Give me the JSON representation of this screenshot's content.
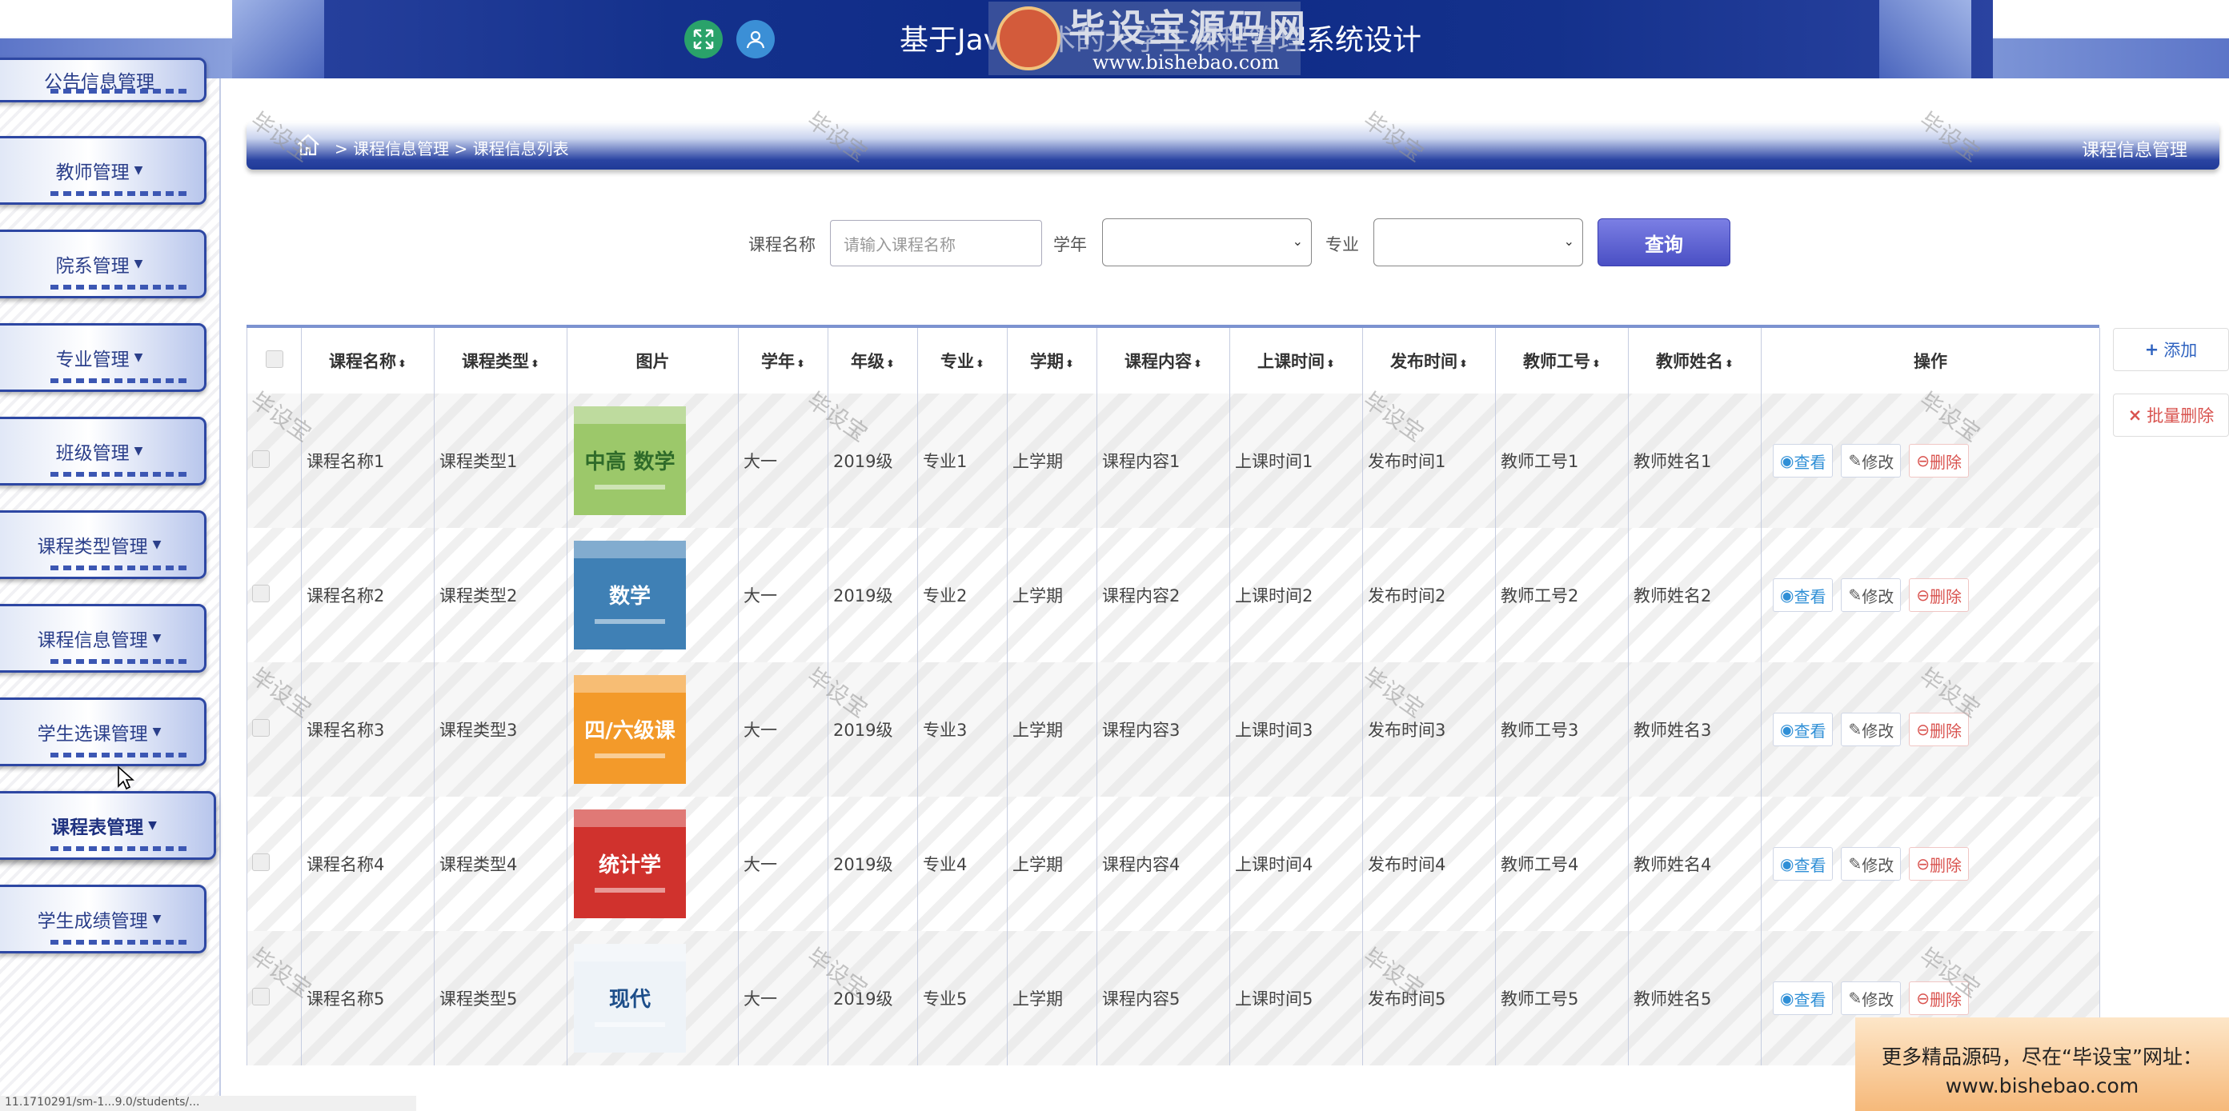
{
  "header": {
    "title": "基于Java技术的大学生课程管理系统设计",
    "logo_text": "毕设宝源码网",
    "logo_url": "www.bishebao.com",
    "icons": [
      "expand-icon",
      "user-icon"
    ]
  },
  "sidebar": {
    "items": [
      {
        "label": "公告信息管理"
      },
      {
        "label": "教师管理"
      },
      {
        "label": "院系管理"
      },
      {
        "label": "专业管理"
      },
      {
        "label": "班级管理"
      },
      {
        "label": "课程类型管理"
      },
      {
        "label": "课程信息管理"
      },
      {
        "label": "学生选课管理"
      },
      {
        "label": "课程表管理",
        "active": true
      },
      {
        "label": "学生成绩管理"
      }
    ]
  },
  "breadcrumb": {
    "path": "> 课程信息管理 > 课程信息列表",
    "section": "课程信息管理"
  },
  "search": {
    "name_label": "课程名称",
    "name_placeholder": "请输入课程名称",
    "year_label": "学年",
    "year_value": "",
    "major_label": "专业",
    "major_value": "",
    "button": "查询"
  },
  "table": {
    "headers": [
      "课程名称",
      "课程类型",
      "图片",
      "学年",
      "年级",
      "专业",
      "学期",
      "课程内容",
      "上课时间",
      "发布时间",
      "教师工号",
      "教师姓名",
      "操作"
    ],
    "rows": [
      {
        "name": "课程名称1",
        "type": "课程类型1",
        "year": "大一",
        "grade": "2019级",
        "major": "专业1",
        "term": "上学期",
        "content": "课程内容1",
        "time": "上课时间1",
        "publish": "发布时间1",
        "tid": "教师工号1",
        "tname": "教师姓名1"
      },
      {
        "name": "课程名称2",
        "type": "课程类型2",
        "year": "大一",
        "grade": "2019级",
        "major": "专业2",
        "term": "上学期",
        "content": "课程内容2",
        "time": "上课时间2",
        "publish": "发布时间2",
        "tid": "教师工号2",
        "tname": "教师姓名2"
      },
      {
        "name": "课程名称3",
        "type": "课程类型3",
        "year": "大一",
        "grade": "2019级",
        "major": "专业3",
        "term": "上学期",
        "content": "课程内容3",
        "time": "上课时间3",
        "publish": "发布时间3",
        "tid": "教师工号3",
        "tname": "教师姓名3"
      },
      {
        "name": "课程名称4",
        "type": "课程类型4",
        "year": "大一",
        "grade": "2019级",
        "major": "专业4",
        "term": "上学期",
        "content": "课程内容4",
        "time": "上课时间4",
        "publish": "发布时间4",
        "tid": "教师工号4",
        "tname": "教师姓名4"
      },
      {
        "name": "课程名称5",
        "type": "课程类型5",
        "year": "大一",
        "grade": "2019级",
        "major": "专业5",
        "term": "上学期",
        "content": "课程内容5",
        "time": "上课时间5",
        "publish": "发布时间5",
        "tid": "教师工号5",
        "tname": "教师姓名5"
      }
    ],
    "actions": {
      "view": "查看",
      "edit": "修改",
      "delete": "删除"
    }
  },
  "side_actions": {
    "add": "添加",
    "batch_delete": "批量删除"
  },
  "book_covers": [
    {
      "text": "中高 数学",
      "bg": "#9cc86a",
      "fg": "#2f6b2a"
    },
    {
      "text": "数学",
      "bg": "#3f80b5",
      "fg": "#ffffff"
    },
    {
      "text": "四/六级课",
      "bg": "#f39a2a",
      "fg": "#ffffff"
    },
    {
      "text": "统计学",
      "bg": "#d0322d",
      "fg": "#ffffff"
    },
    {
      "text": "现代",
      "bg": "#eef3f8",
      "fg": "#1d4e8a"
    }
  ],
  "watermark": "毕设宝",
  "ad": {
    "line1": "更多精品源码，尽在“毕设宝”网址：",
    "line2": "www.bishebao.com"
  },
  "status_bar": "11.1710291/sm-1...9.0/students/... "
}
